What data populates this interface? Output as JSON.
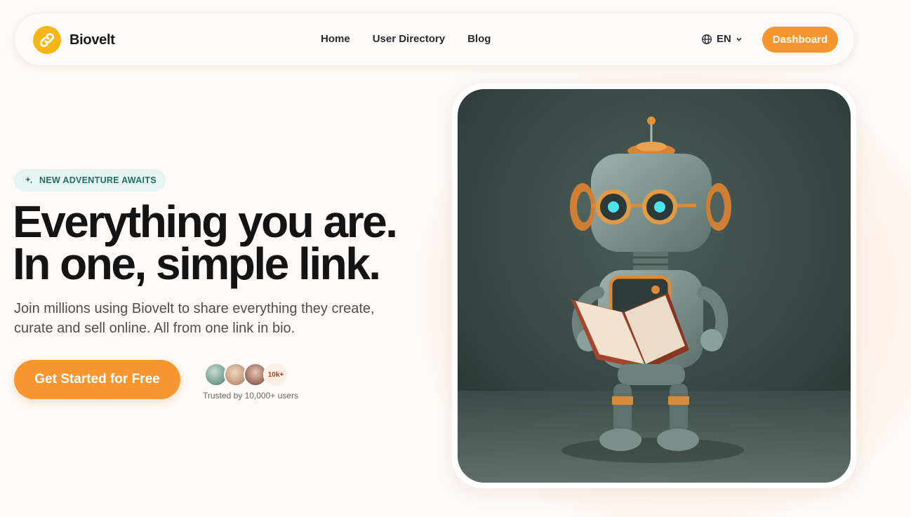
{
  "brand": {
    "name": "Biovelt",
    "logo_icon": "chain-link-icon",
    "logo_color": "#f6b617"
  },
  "nav": {
    "links": [
      {
        "label": "Home"
      },
      {
        "label": "User Directory"
      },
      {
        "label": "Blog"
      }
    ],
    "language": {
      "label": "EN",
      "icon": "globe-icon"
    },
    "dashboard_label": "Dashboard"
  },
  "hero": {
    "badge": "NEW ADVENTURE AWAITS",
    "headline_line1": "Everything you are.",
    "headline_line2": "In one, simple link.",
    "subtext": "Join millions using Biovelt to share everything they create, curate and sell online. All from one link in bio.",
    "cta_label": "Get Started for Free",
    "users_count_badge": "10k+",
    "trust_text": "Trusted by 10,000+ users",
    "image_subject": "robot reading a book"
  },
  "colors": {
    "accent": "#f7962e",
    "badge_bg": "#e6f3f0",
    "badge_text": "#1f6f63",
    "page_bg": "#fcf9f7"
  }
}
